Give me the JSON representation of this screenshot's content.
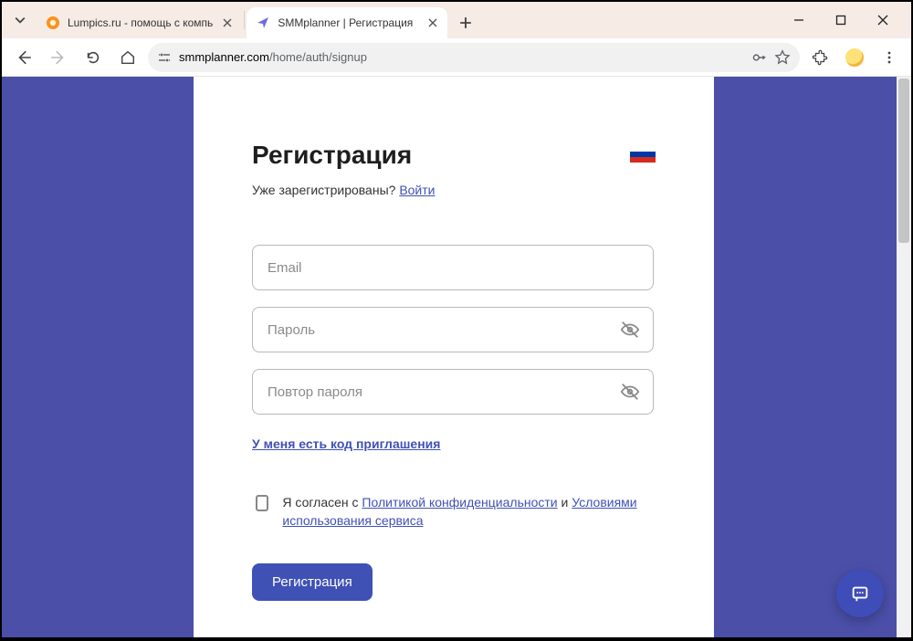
{
  "browser": {
    "tabs": [
      {
        "title": "Lumpics.ru - помощь с компь",
        "active": false,
        "favicon": "lumpics"
      },
      {
        "title": "SMMplanner | Регистрация",
        "active": true,
        "favicon": "smmplanner"
      }
    ],
    "url_host": "smmplanner.com",
    "url_path": "/home/auth/signup"
  },
  "page": {
    "heading": "Регистрация",
    "already_text": "Уже зарегистрированы? ",
    "login_link": "Войти",
    "email_placeholder": "Email",
    "password_placeholder": "Пароль",
    "password_repeat_placeholder": "Повтор пароля",
    "invite_link": "У меня есть код приглашения",
    "consent_prefix": "Я согласен с ",
    "consent_privacy": "Политикой конфиденциальности",
    "consent_and": " и ",
    "consent_terms": "Условиями использования сервиса",
    "submit_label": "Регистрация",
    "language": "ru"
  }
}
